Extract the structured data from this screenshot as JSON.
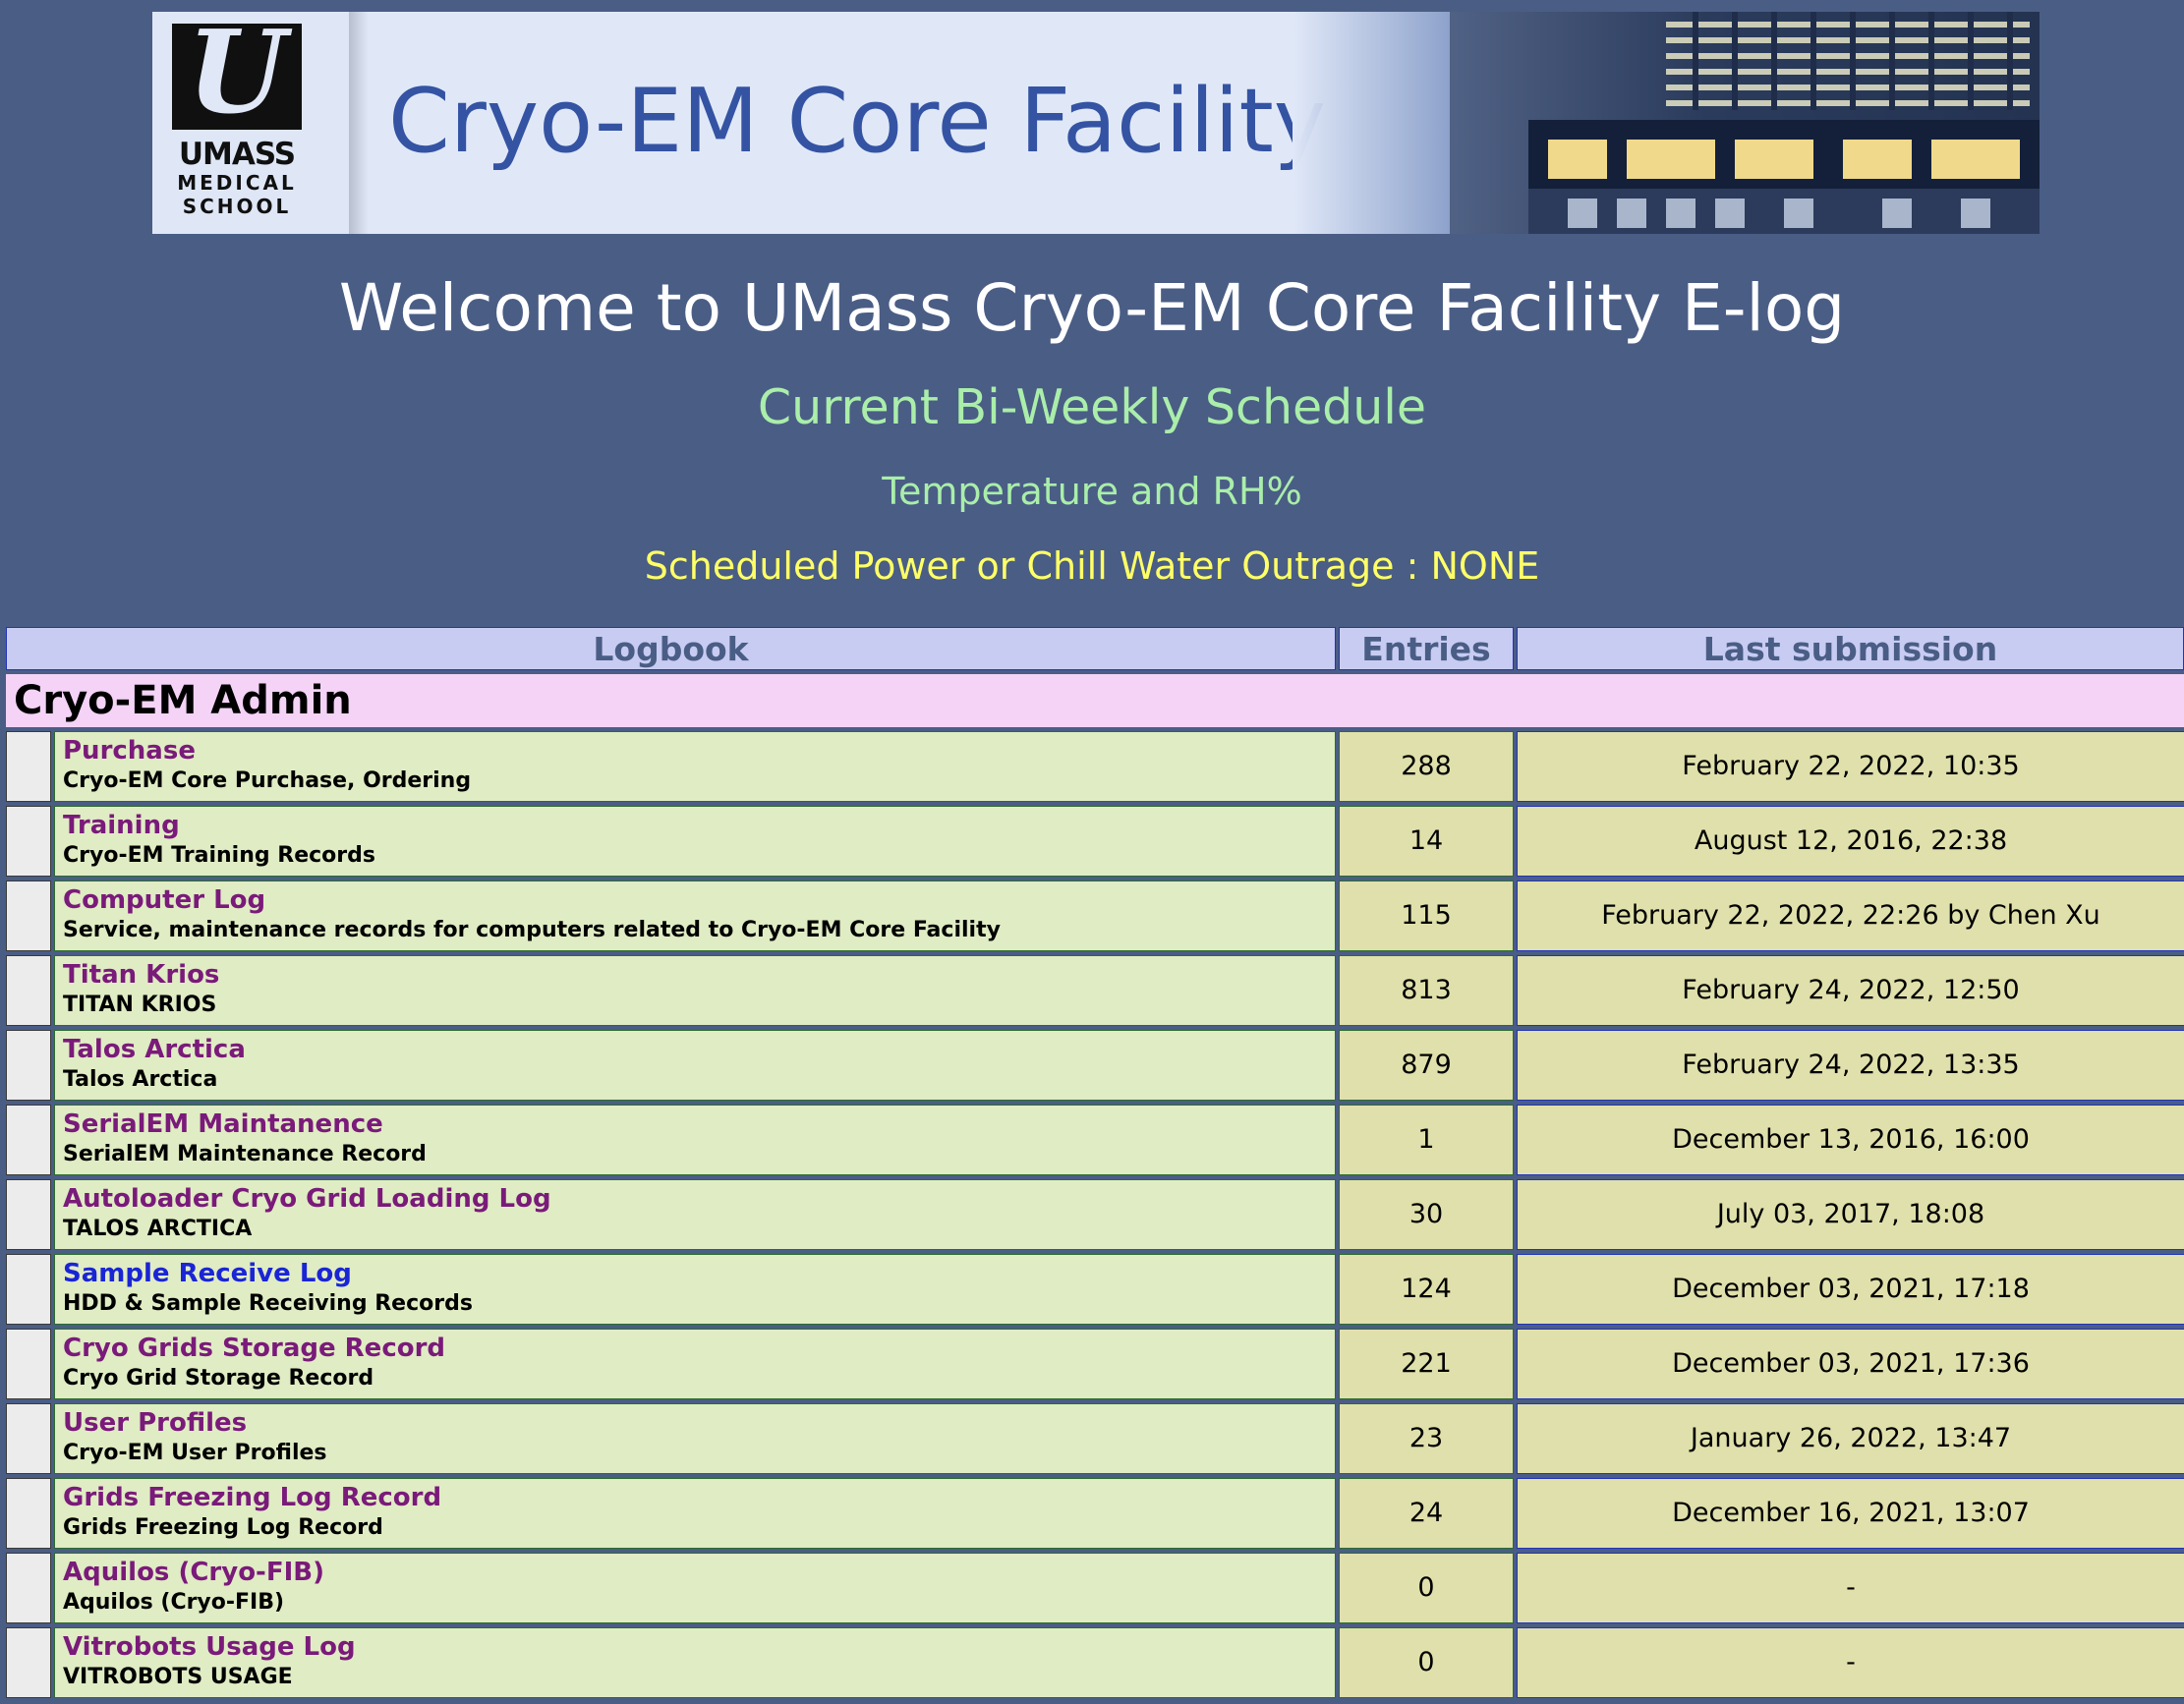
{
  "banner": {
    "logo_line1": "UMASS",
    "logo_line2": "MEDICAL",
    "logo_line3": "SCHOOL",
    "title": "Cryo-EM Core Facility"
  },
  "header": {
    "welcome": "Welcome to UMass Cryo-EM Core Facility E-log",
    "schedule_link": "Current Bi-Weekly Schedule",
    "temperature_link": "Temperature and RH%",
    "outage_notice": "Scheduled Power or Chill Water Outrage : NONE"
  },
  "table": {
    "columns": [
      "Logbook",
      "Entries",
      "Last submission"
    ],
    "group": "Cryo-EM Admin",
    "rows": [
      {
        "title": "Purchase",
        "desc": "Cryo-EM Core Purchase, Ordering",
        "entries": "288",
        "last": "February 22, 2022, 10:35"
      },
      {
        "title": "Training",
        "desc": "Cryo-EM Training Records",
        "entries": "14",
        "last": "August 12, 2016, 22:38"
      },
      {
        "title": "Computer Log",
        "desc": "Service, maintenance records for computers related to Cryo-EM Core Facility",
        "entries": "115",
        "last": "February 22, 2022, 22:26 by Chen Xu"
      },
      {
        "title": "Titan Krios",
        "desc": "TITAN KRIOS",
        "entries": "813",
        "last": "February 24, 2022, 12:50"
      },
      {
        "title": "Talos Arctica",
        "desc": "Talos Arctica",
        "entries": "879",
        "last": "February 24, 2022, 13:35"
      },
      {
        "title": "SerialEM Maintanence",
        "desc": "SerialEM Maintenance Record",
        "entries": "1",
        "last": "December 13, 2016, 16:00"
      },
      {
        "title": "Autoloader Cryo Grid Loading Log",
        "desc": "TALOS ARCTICA",
        "entries": "30",
        "last": "July 03, 2017, 18:08"
      },
      {
        "title": "Sample Receive Log",
        "desc": "HDD & Sample Receiving Records",
        "entries": "124",
        "last": "December 03, 2021, 17:18"
      },
      {
        "title": "Cryo Grids Storage Record",
        "desc": "Cryo Grid Storage Record",
        "entries": "221",
        "last": "December 03, 2021, 17:36"
      },
      {
        "title": "User Profiles",
        "desc": "Cryo-EM User Profiles",
        "entries": "23",
        "last": "January 26, 2022, 13:47"
      },
      {
        "title": "Grids Freezing Log Record",
        "desc": "Grids Freezing Log Record",
        "entries": "24",
        "last": "December 16, 2021, 13:07"
      },
      {
        "title": "Aquilos (Cryo-FIB)",
        "desc": "Aquilos (Cryo-FIB)",
        "entries": "0",
        "last": "-"
      },
      {
        "title": "Vitrobots Usage Log",
        "desc": "VITROBOTS USAGE",
        "entries": "0",
        "last": "-"
      }
    ]
  },
  "colors": {
    "page_bg": "#4a5d85",
    "visited_link": "#7a1a7a",
    "unvisited_link": "#1a25d6",
    "name_cell_bg": "#e0ecc4",
    "value_cell_bg": "#e0e0ac",
    "group_bg": "#f4d3f7",
    "header_bg": "#c8ccf2"
  }
}
